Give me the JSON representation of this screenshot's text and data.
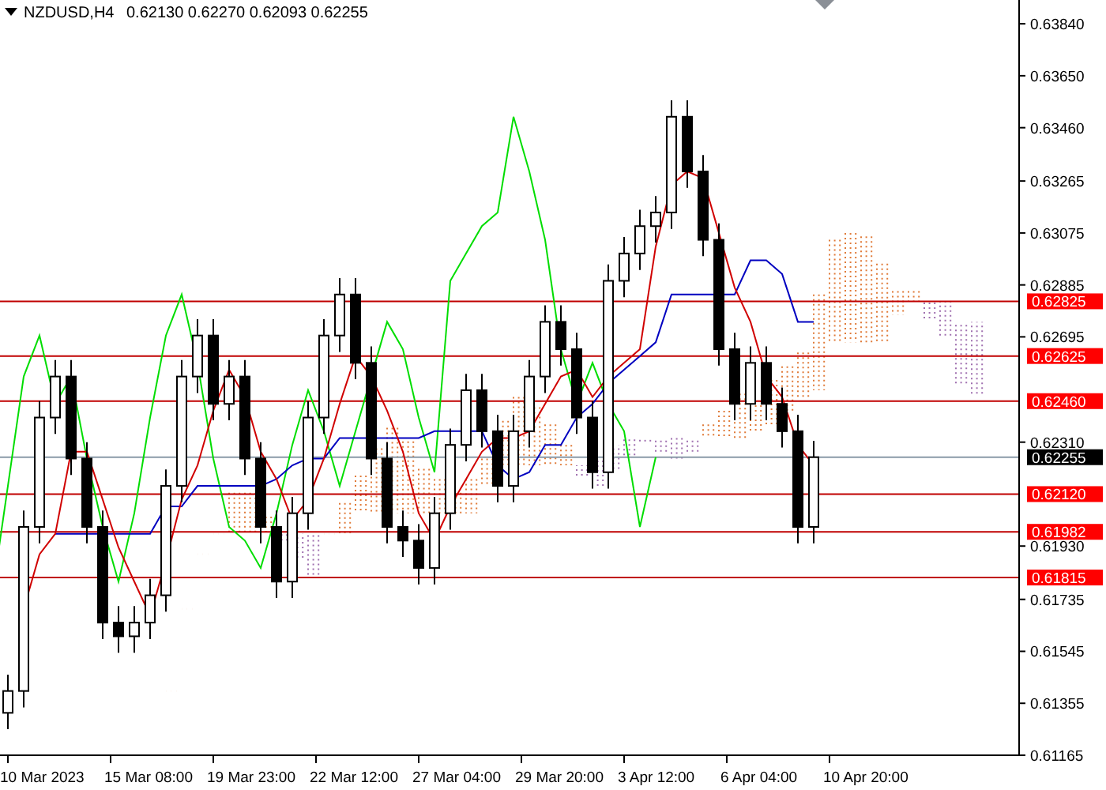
{
  "header": {
    "symbol": "NZDUSD,H4",
    "ohlc": "0.62130 0.62270 0.62093 0.62255"
  },
  "price_axis": [
    "0.63840",
    "0.63650",
    "0.63460",
    "0.63265",
    "0.63075",
    "0.62885",
    "0.62695",
    "0.62310",
    "0.61930",
    "0.61735",
    "0.61545",
    "0.61355",
    "0.61165"
  ],
  "time_axis": [
    "10 Mar 2023",
    "15 Mar 08:00",
    "19 Mar 23:00",
    "22 Mar 12:00",
    "27 Mar 04:00",
    "29 Mar 20:00",
    "3 Apr 12:00",
    "6 Apr 04:00",
    "10 Apr 20:00"
  ],
  "price_levels": [
    {
      "label": "0.62825"
    },
    {
      "label": "0.62625"
    },
    {
      "label": "0.62460"
    },
    {
      "label": "0.62120"
    },
    {
      "label": "0.61982"
    },
    {
      "label": "0.61815"
    }
  ],
  "current_price": {
    "label": "0.62255"
  }
}
